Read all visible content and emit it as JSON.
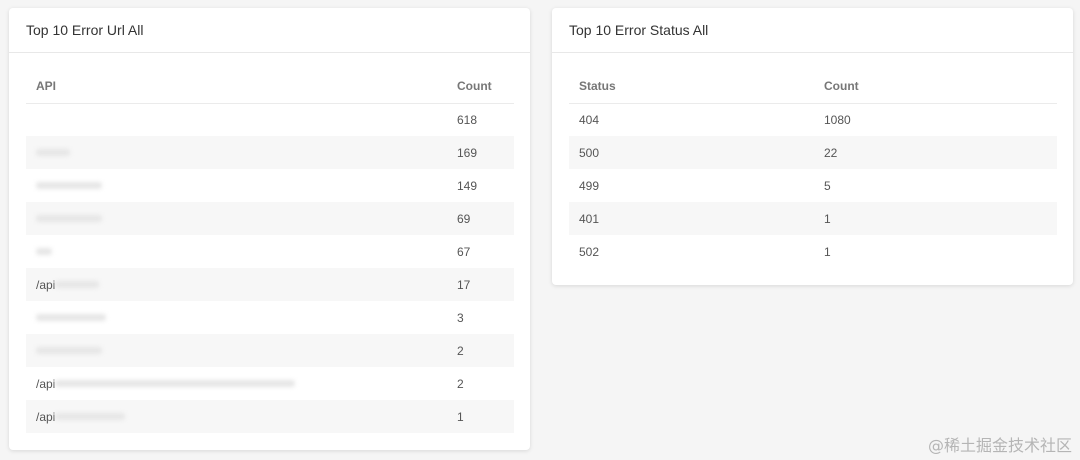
{
  "url_card": {
    "title": "Top 10 Error Url All",
    "columns": {
      "api": "API",
      "count": "Count"
    },
    "rows": [
      {
        "prefix": "",
        "count": "618",
        "blur": 0,
        "tail": ""
      },
      {
        "prefix": "",
        "count": "169",
        "blur": 34,
        "tail": ""
      },
      {
        "prefix": "",
        "count": "149",
        "blur": 66,
        "tail": ""
      },
      {
        "prefix": "",
        "count": "69",
        "blur": 66,
        "tail": ""
      },
      {
        "prefix": "",
        "count": "67",
        "blur": 16,
        "tail": ""
      },
      {
        "prefix": "/api",
        "count": "17",
        "blur": 44,
        "tail": ""
      },
      {
        "prefix": "",
        "count": "3",
        "blur": 70,
        "tail": ""
      },
      {
        "prefix": "",
        "count": "2",
        "blur": 66,
        "tail": ""
      },
      {
        "prefix": "/api",
        "count": "2",
        "blur": 240,
        "tail": ""
      },
      {
        "prefix": "/api",
        "count": "1",
        "blur": 70,
        "tail": ""
      }
    ]
  },
  "status_card": {
    "title": "Top 10 Error Status All",
    "columns": {
      "status": "Status",
      "count": "Count"
    },
    "rows": [
      {
        "status": "404",
        "count": "1080"
      },
      {
        "status": "500",
        "count": "22"
      },
      {
        "status": "499",
        "count": "5"
      },
      {
        "status": "401",
        "count": "1"
      },
      {
        "status": "502",
        "count": "1"
      }
    ]
  },
  "watermark": "@稀土掘金技术社区"
}
